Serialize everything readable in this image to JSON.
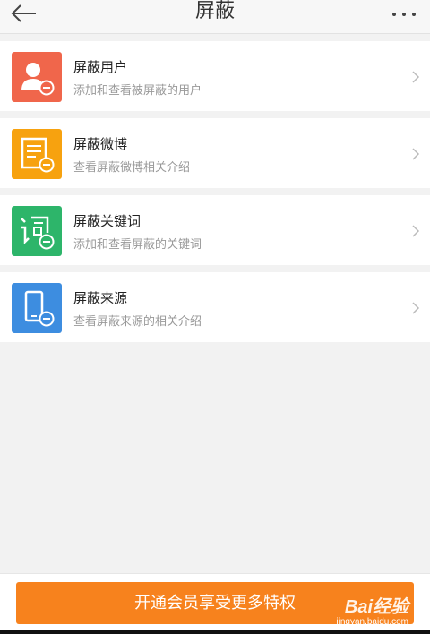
{
  "header": {
    "title": "屏蔽",
    "back_icon": "arrow-left-icon",
    "more_icon": "more-dots-icon"
  },
  "items": [
    {
      "name": "屏蔽用户",
      "desc": "添加和查看被屏蔽的用户",
      "icon": "block-user-icon",
      "color": "#f0664b"
    },
    {
      "name": "屏蔽微博",
      "desc": "查看屏蔽微博相关介绍",
      "icon": "block-weibo-icon",
      "color": "#f7a20f"
    },
    {
      "name": "屏蔽关键词",
      "desc": "添加和查看屏蔽的关键词",
      "icon": "block-keyword-icon",
      "color": "#2db56a"
    },
    {
      "name": "屏蔽来源",
      "desc": "查看屏蔽来源的相关介绍",
      "icon": "block-source-icon",
      "color": "#3d8de0"
    }
  ],
  "footer": {
    "vip_label": "开通会员享受更多特权",
    "color": "#f7821d"
  },
  "watermark": {
    "brand": "Bai经验",
    "url": "jingyan.baidu.com"
  }
}
